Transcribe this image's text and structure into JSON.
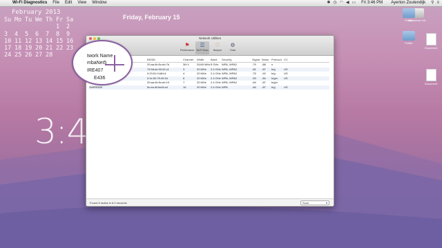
{
  "menubar": {
    "app_name": "Wi-Fi Diagnostics",
    "items": [
      "File",
      "Edit",
      "View",
      "Window"
    ],
    "clock": "Fri 3:46 PM",
    "user": "Ayerton Zoutendijk"
  },
  "calendar": {
    "title": "February 2013",
    "weekdays": [
      "Su",
      "Mo",
      "Tu",
      "We",
      "Th",
      "Fr",
      "Sa"
    ],
    "weeks": [
      [
        "",
        "",
        "",
        "",
        "",
        "1",
        "2"
      ],
      [
        "3",
        "4",
        "5",
        "6",
        "7",
        "8",
        "9"
      ],
      [
        "10",
        "11",
        "12",
        "13",
        "14",
        "15",
        "16"
      ],
      [
        "17",
        "18",
        "19",
        "20",
        "21",
        "22",
        "23"
      ],
      [
        "24",
        "25",
        "26",
        "27",
        "28",
        "",
        ""
      ]
    ]
  },
  "date_label": "Friday, February 15",
  "big_clock": "3:4",
  "desktop_icons": [
    {
      "label": "Macintosh HD"
    },
    {
      "label": "Folder"
    },
    {
      "label": "Folder"
    },
    {
      "label": "Document"
    },
    {
      "label": "Document"
    }
  ],
  "window": {
    "title": "Network Utilities",
    "toolbar": [
      {
        "label": "Performance",
        "icon": "performance-icon"
      },
      {
        "label": "Wi-Fi Scan",
        "icon": "wifi-scan-icon",
        "active": true
      },
      {
        "label": "Bonjour",
        "icon": "bonjour-icon"
      },
      {
        "label": "Tools",
        "icon": "tools-icon"
      }
    ],
    "columns": [
      "Network Name",
      "BSSID",
      "Channel",
      "Width",
      "Band",
      "Security",
      "Signal",
      "Noise",
      "Protocol",
      "CC"
    ],
    "rows": [
      [
        "",
        "20:aa:4b:5c:eb:7b",
        "36+1",
        "20/40 MHz",
        "5 GHz",
        "WPA, WPA2",
        "-79",
        "-88",
        "n",
        ""
      ],
      [
        "",
        "74:9d:dc:93:42:c1",
        "3",
        "20 MHz",
        "2.4 GHz",
        "WPA, WPA2",
        "-81",
        "-87",
        "b/g",
        "US"
      ],
      [
        "",
        "0:23:51:0:b8:b1",
        "4",
        "20 MHz",
        "2.4 GHz",
        "WPA, WPA2",
        "-75",
        "-92",
        "b/g",
        "US"
      ],
      [
        "",
        "0:1e:52:79:49:1b",
        "6",
        "20 MHz",
        "2.4 GHz",
        "WPA, WPA2",
        "-53",
        "-84",
        "b/g/n",
        "US"
      ],
      [
        "",
        "20:aa:4b:5c:eb:19",
        "7",
        "20 MHz",
        "2.4 GHz",
        "WPA, WPA2",
        "-84",
        "-87",
        "b/g/n",
        ""
      ],
      [
        "2WIRE626",
        "5c:ea:4f:8a:f4:a4",
        "10",
        "20 MHz",
        "2.4 GHz",
        "WPA",
        "-84",
        "-87",
        "b/g",
        "US"
      ]
    ],
    "status": "Found 6 radios in 6.0 seconds",
    "scan_button": "Scan"
  },
  "zoom": {
    "lines": [
      "twork Name",
      "mbaNet5",
      "IRE407",
      "E436"
    ]
  }
}
